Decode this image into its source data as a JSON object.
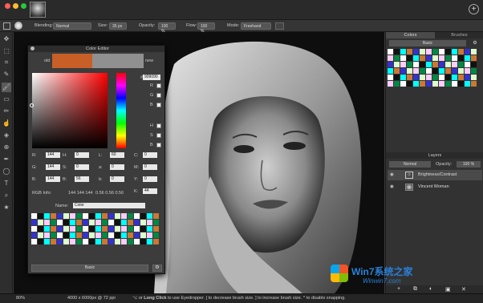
{
  "toolbar": {
    "blending_label": "Blending:",
    "blending_value": "Normal",
    "size_label": "Size:",
    "size_value": "35 px",
    "opacity_label": "Opacity:",
    "opacity_value": "100 %",
    "flow_label": "Flow:",
    "flow_value": "100 %",
    "mode_label": "Mode:",
    "mode_value": "Freehand"
  },
  "color_editor": {
    "title": "Color Editor",
    "old_label": "old",
    "new_label": "new",
    "hex_symbol": "#",
    "hex_value": "909090",
    "old_color": "#c75f27",
    "new_color": "#909090",
    "channels": [
      {
        "l": "R:",
        "v": "144"
      },
      {
        "l": "G:",
        "v": "144"
      },
      {
        "l": "B:",
        "v": "144"
      }
    ],
    "hsl": [
      {
        "l": "H:",
        "v": "0"
      },
      {
        "l": "S:",
        "v": "0"
      },
      {
        "l": "B:",
        "v": "56"
      }
    ],
    "lab": [
      {
        "l": "L:",
        "v": "60"
      },
      {
        "l": "a:",
        "v": "0"
      },
      {
        "l": "b:",
        "v": "0"
      }
    ],
    "cmyk": [
      {
        "l": "C:",
        "v": "0"
      },
      {
        "l": "M:",
        "v": "0"
      },
      {
        "l": "Y:",
        "v": "0"
      },
      {
        "l": "K:",
        "v": "44"
      }
    ],
    "check_labels": [
      "R",
      "G",
      "B",
      "H",
      "S",
      "B"
    ],
    "rgb_info_label": "RGB Info:",
    "rgb_info_value": "144 144 144",
    "rgb_info_value2": "0.56 0.56 0.56",
    "name_label": "Name:",
    "name_value": "Color",
    "preset_value": "Basic"
  },
  "right_panel": {
    "tab_colors": "Colors",
    "tab_brushes": "Brushes",
    "swatch_set": "Basic",
    "layers_title": "Layers",
    "layer_blend": "Normal",
    "layer_opacity_label": "Opacity:",
    "layer_opacity_value": "100 %",
    "layers": [
      {
        "name": "Brightness/Contrast"
      },
      {
        "name": "Vincent Woman"
      }
    ]
  },
  "status": {
    "zoom": "80%",
    "dimensions": "4000 x 6000px @ 72 ppi",
    "hint_a": "⌥ or",
    "hint_long_click": "Long Click",
    "hint_b": "to use Eyedropper.",
    "hint_c": "[ to decrease brush size.",
    "hint_d": "] to increase brush size.",
    "hint_e": "^ to disable snapping."
  },
  "watermark": {
    "text": "Win7系统之家",
    "url": "Winwin7.com"
  }
}
